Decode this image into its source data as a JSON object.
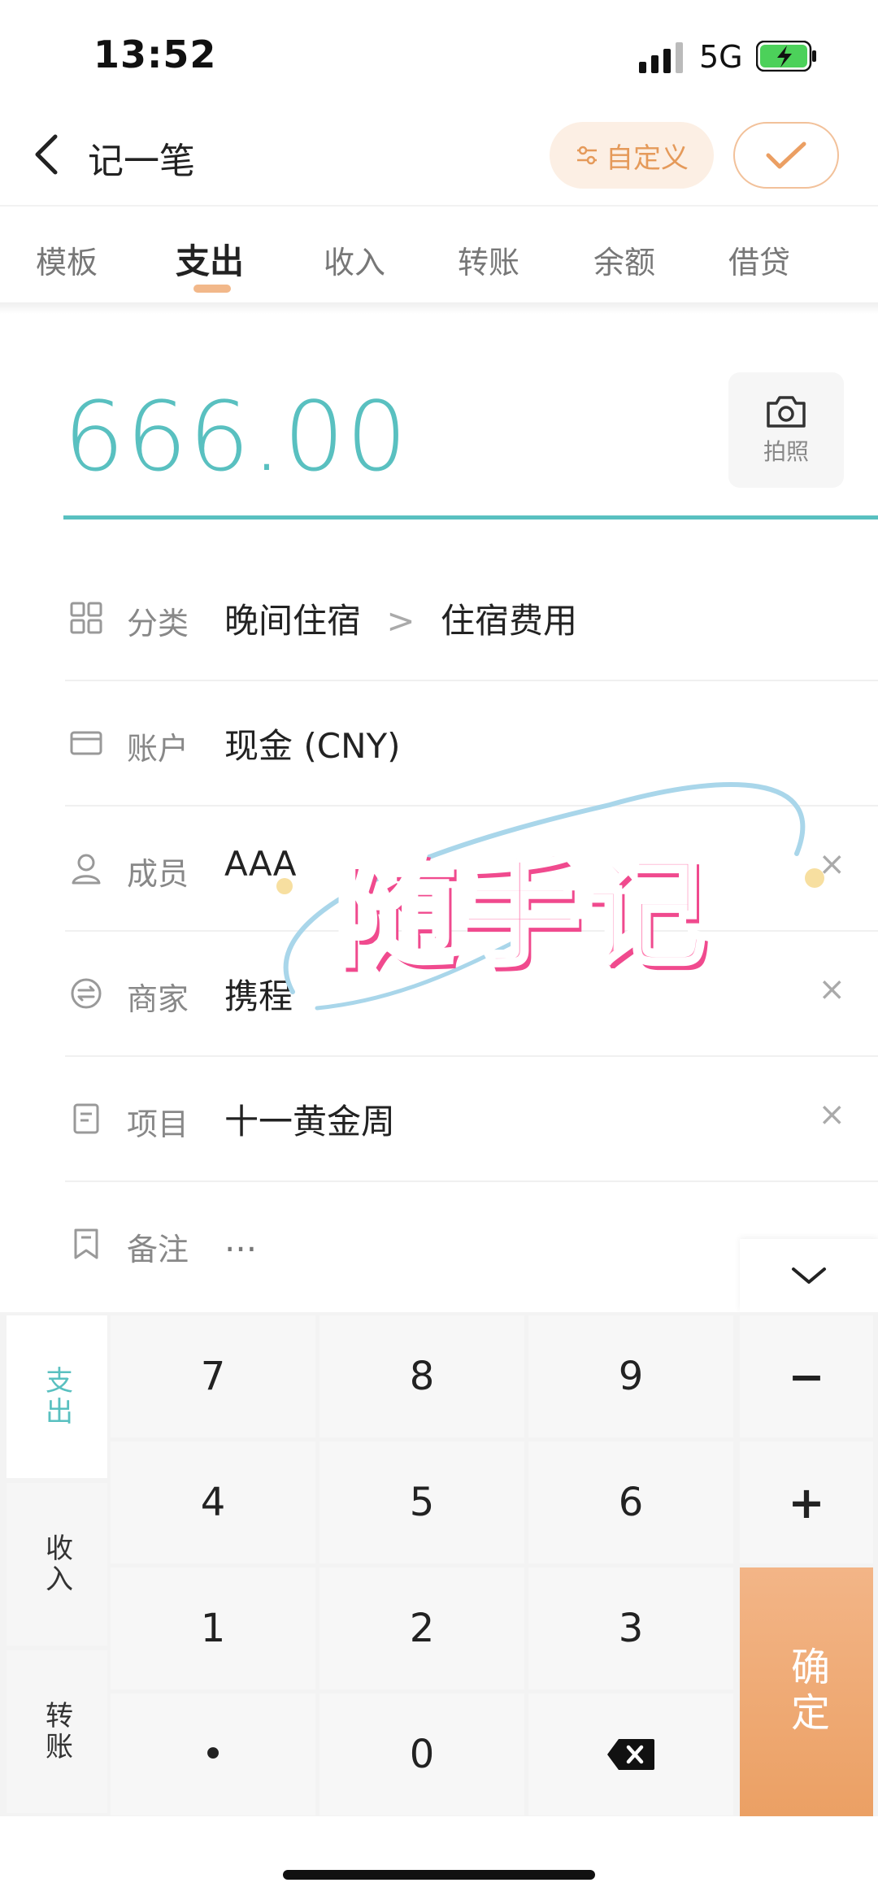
{
  "status_bar": {
    "time": "13:52",
    "network": "5G"
  },
  "header": {
    "title": "记一笔",
    "custom_label": "自定义"
  },
  "tabs": [
    {
      "label": "模板",
      "active": false
    },
    {
      "label": "支出",
      "active": true
    },
    {
      "label": "收入",
      "active": false
    },
    {
      "label": "转账",
      "active": false
    },
    {
      "label": "余额",
      "active": false
    },
    {
      "label": "借贷",
      "active": false
    }
  ],
  "amount": {
    "value": "666.00",
    "photo_label": "拍照"
  },
  "fields": {
    "category": {
      "label": "分类",
      "main": "晚间住宿",
      "separator": ">",
      "sub": "住宿费用"
    },
    "account": {
      "label": "账户",
      "value": "现金 (CNY)"
    },
    "member": {
      "label": "成员",
      "value": "AAA"
    },
    "merchant": {
      "label": "商家",
      "value": "携程"
    },
    "project": {
      "label": "项目",
      "value": "十一黄金周"
    },
    "note": {
      "label": "备注",
      "placeholder": "..."
    }
  },
  "clear_icon": "×",
  "watermark": {
    "text": "随手记"
  },
  "keypad": {
    "side_tabs": [
      {
        "label": "支出",
        "active": true
      },
      {
        "label": "收入",
        "active": false
      },
      {
        "label": "转账",
        "active": false
      }
    ],
    "keys": [
      "7",
      "8",
      "9",
      "4",
      "5",
      "6",
      "1",
      "2",
      "3",
      "•",
      "0"
    ],
    "minus": "−",
    "plus": "+",
    "confirm": "确定"
  },
  "colors": {
    "accent": "#59c0c0",
    "orange": "#eba064",
    "watermark_pink": "#ff7fb1"
  }
}
